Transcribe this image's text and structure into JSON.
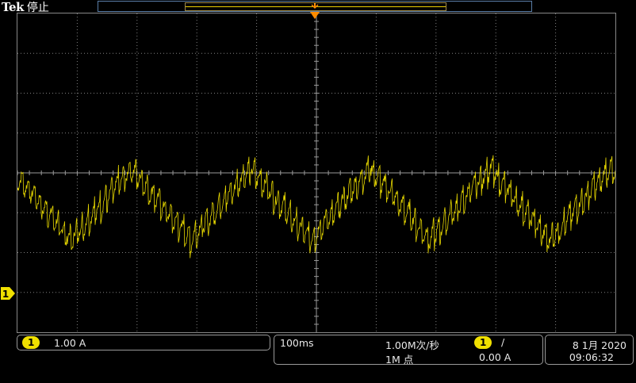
{
  "header": {
    "brand": "Tek",
    "run_state": "停止"
  },
  "channel1": {
    "badge": "1",
    "scale": "1.00 A",
    "ground_marker": "1"
  },
  "horizontal": {
    "time_per_div": "100ms",
    "sample_rate": "1.00M次/秒",
    "record_length": "1M 点"
  },
  "trigger": {
    "source_badge": "1",
    "slope_symbol": "/",
    "level": "0.00 A"
  },
  "datetime": {
    "date": "8 1月 2020",
    "time": "09:06:32"
  },
  "colors": {
    "trace": "#f0e000",
    "trigger_marker": "#ff8c00",
    "grid": "#808080",
    "background": "#000000"
  },
  "trace_params": {
    "period_fraction": 0.2,
    "center_div": -0.8,
    "triangle_amp_div": 0.9,
    "ripple_amp_div": 0.45
  }
}
